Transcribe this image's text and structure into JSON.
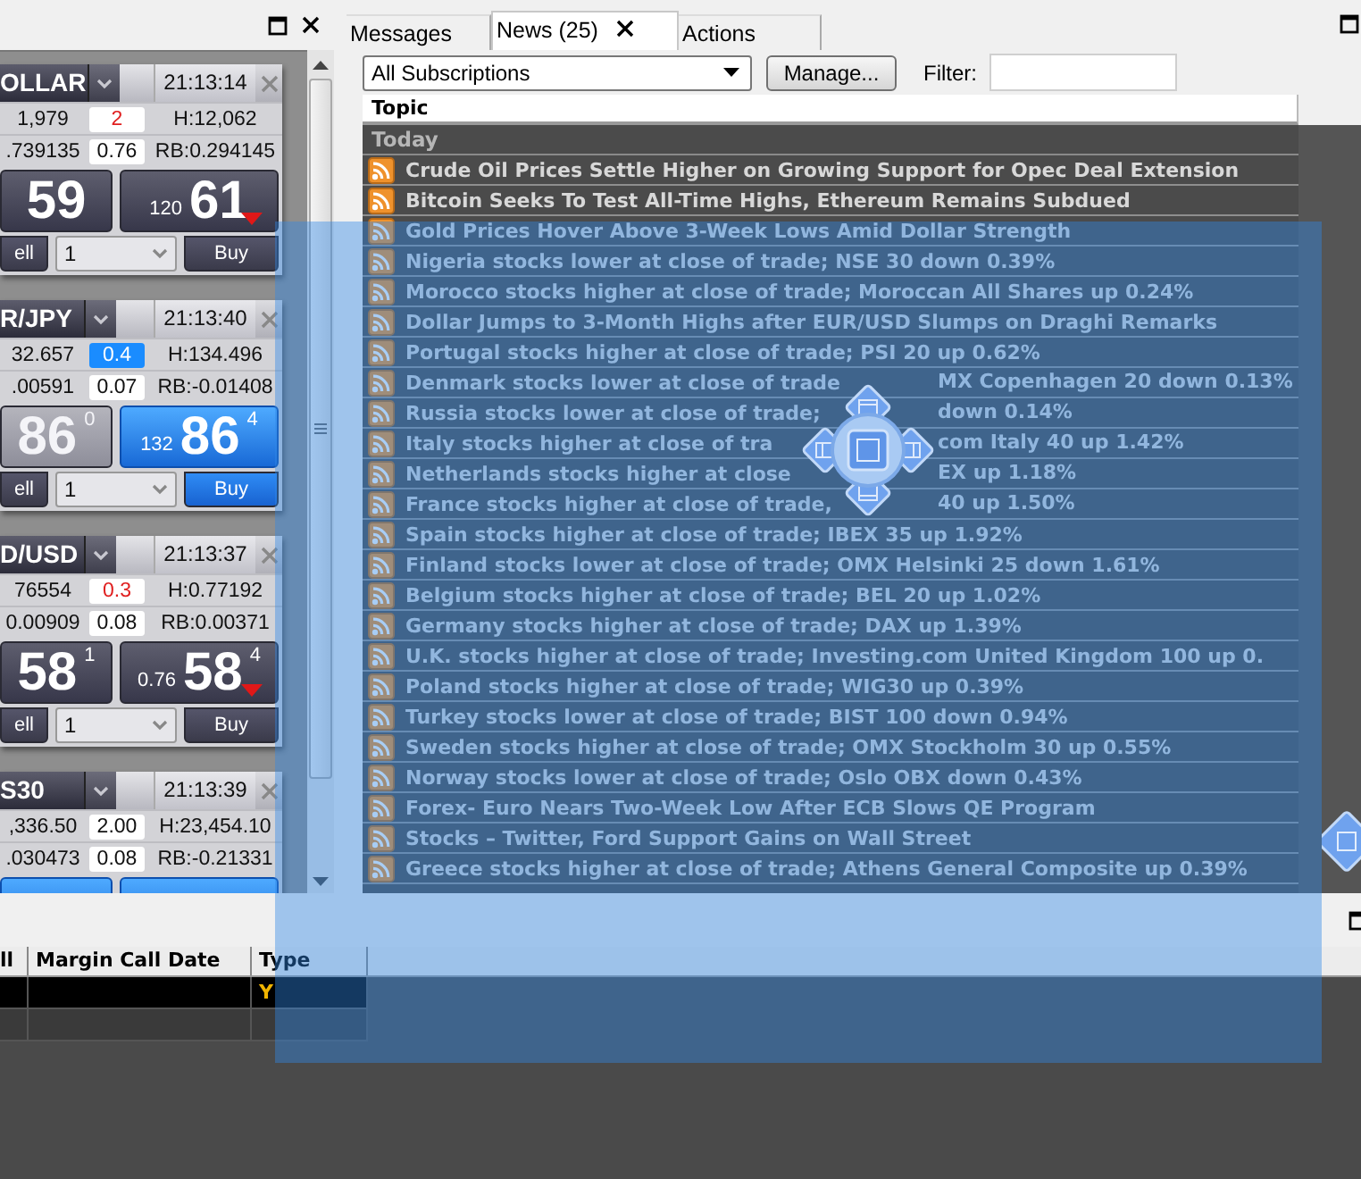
{
  "left_panel": {
    "quote_tiles": [
      {
        "name": "OLLAR",
        "time": "21:13:14",
        "low": "1,979",
        "spread": "2",
        "spread_up": false,
        "spread_down": true,
        "high": "H:12,062",
        "swap": ".739135",
        "swap_change": "0.76",
        "rollover": "RB:0.294145",
        "sell": {
          "price": "59",
          "dimmed": false,
          "highlighted": false
        },
        "buy": {
          "pips": "120",
          "price": "61",
          "highlighted": false,
          "tick_down": true
        },
        "trade": {
          "sell_label": "ell",
          "quantity": "1",
          "buy_label": "Buy"
        }
      },
      {
        "name": "R/JPY",
        "time": "21:13:40",
        "low": "32.657",
        "spread": "0.4",
        "spread_up": true,
        "spread_down": false,
        "high": "H:134.496",
        "swap": ".00591",
        "swap_change": "0.07",
        "rollover": "RB:-0.01408",
        "sell": {
          "price": "86",
          "sup": "0",
          "dimmed": true,
          "highlighted": false
        },
        "buy": {
          "pips": "132",
          "price": "86",
          "sup": "4",
          "highlighted": true,
          "tick_down": false
        },
        "trade": {
          "sell_label": "ell",
          "quantity": "1",
          "buy_label": "Buy"
        }
      },
      {
        "name": "D/USD",
        "time": "21:13:37",
        "low": "76554",
        "spread": "0.3",
        "spread_up": false,
        "spread_down": true,
        "high": "H:0.77192",
        "swap": "0.00909",
        "swap_change": "0.08",
        "rollover": "RB:0.00371",
        "sell": {
          "price": "58",
          "sup": "1",
          "dimmed": false,
          "highlighted": false
        },
        "buy": {
          "pips": "0.76",
          "price": "58",
          "sup": "4",
          "highlighted": false,
          "tick_down": true
        },
        "trade": {
          "sell_label": "ell",
          "quantity": "1",
          "buy_label": "Buy"
        }
      },
      {
        "name": "S30",
        "time": "21:13:39",
        "low": ",336.50",
        "spread": "2.00",
        "spread_up": false,
        "spread_down": false,
        "high": "H:23,454.10",
        "swap": ".030473",
        "swap_change": "0.08",
        "rollover": "RB:-0.21331",
        "sell": {
          "dimmed": false,
          "highlighted": true
        },
        "buy": {
          "highlighted": true,
          "tick_down": false
        }
      }
    ]
  },
  "news_panel": {
    "tabs": [
      {
        "label": "Messages",
        "selected": false,
        "closable": false
      },
      {
        "label": "News (25)",
        "selected": true,
        "closable": true
      },
      {
        "label": "Actions",
        "selected": false,
        "closable": false
      }
    ],
    "subscription_select": "All Subscriptions",
    "manage_button": "Manage...",
    "filter_label": "Filter:",
    "columns": [
      "Topic"
    ],
    "groups": [
      {
        "label": "Today",
        "rows": [
          {
            "text": "Crude Oil Prices Settle Higher on Growing Support for Opec Deal Extension"
          },
          {
            "text": "Bitcoin Seeks To Test All-Time Highs, Ethereum Remains Subdued"
          },
          {
            "text": "Gold Prices Hover Above 3-Week Lows Amid Dollar Strength"
          },
          {
            "text": "Nigeria stocks lower at close of trade; NSE 30 down 0.39%"
          },
          {
            "text": "Morocco stocks higher at close of trade; Moroccan All Shares up 0.24%"
          },
          {
            "text": "Dollar Jumps to 3-Month Highs after EUR/USD Slumps on Draghi Remarks"
          },
          {
            "text": "Portugal stocks higher at close of trade; PSI 20 up 0.62%"
          },
          {
            "text": "Denmark stocks lower at close of trade",
            "text_after": "MX Copenhagen 20 down 0.13%"
          },
          {
            "text": "Russia stocks lower at close of trade;",
            "text_after": "down 0.14%"
          },
          {
            "text": "Italy stocks higher at close of tra",
            "text_after": "com Italy 40 up 1.42%"
          },
          {
            "text": "Netherlands stocks higher at close",
            "text_after": "EX up 1.18%"
          },
          {
            "text": "France stocks higher at close of trade,",
            "text_after": "40 up 1.50%"
          },
          {
            "text": "Spain stocks higher at close of trade; IBEX 35 up 1.92%"
          },
          {
            "text": "Finland stocks lower at close of trade; OMX Helsinki 25 down 1.61%"
          },
          {
            "text": "Belgium stocks higher at close of trade; BEL 20 up 1.02%"
          },
          {
            "text": "Germany stocks higher at close of trade; DAX up 1.39%"
          },
          {
            "text": "U.K. stocks higher at close of trade; Investing.com United Kingdom 100 up 0."
          },
          {
            "text": "Poland stocks higher at close of trade; WIG30 up 0.39%"
          },
          {
            "text": "Turkey stocks lower at close of trade; BIST 100 down 0.94%"
          },
          {
            "text": "Sweden stocks higher at close of trade; OMX Stockholm 30 up 0.55%"
          },
          {
            "text": "Norway stocks lower at close of trade; Oslo OBX down 0.43%"
          },
          {
            "text": "Forex- Euro Nears Two-Week Low After ECB Slows QE Program"
          },
          {
            "text": "Stocks – Twitter, Ford Support Gains on Wall Street"
          },
          {
            "text": "Greece stocks higher at close of trade; Athens General Composite up 0.39%"
          }
        ]
      }
    ]
  },
  "blotter": {
    "columns": [
      "ll",
      "Margin Call Date",
      "Type"
    ],
    "rows": [
      {
        "type": "Y",
        "selected": true
      },
      {
        "selected": false
      }
    ]
  }
}
